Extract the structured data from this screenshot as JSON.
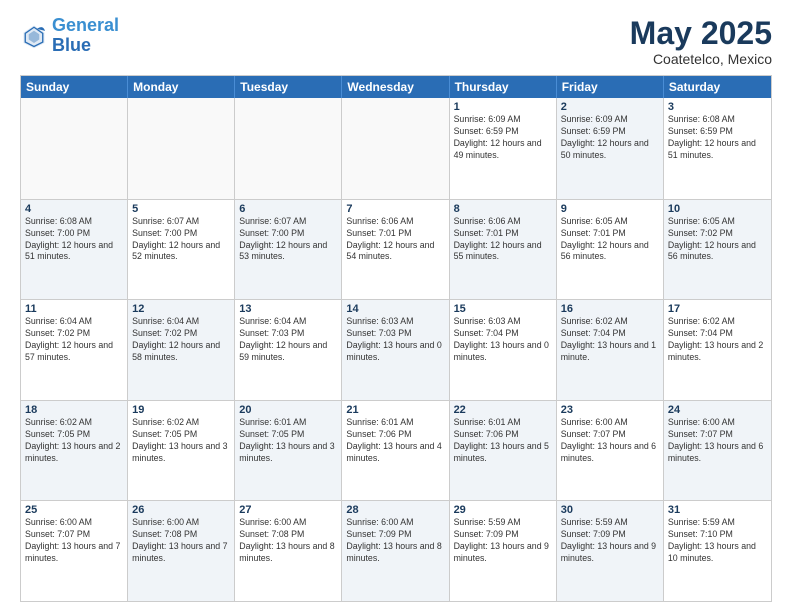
{
  "header": {
    "logo_line1": "General",
    "logo_line2": "Blue",
    "title": "May 2025",
    "location": "Coatetelco, Mexico"
  },
  "weekdays": [
    "Sunday",
    "Monday",
    "Tuesday",
    "Wednesday",
    "Thursday",
    "Friday",
    "Saturday"
  ],
  "weeks": [
    [
      {
        "day": "",
        "info": "",
        "empty": true
      },
      {
        "day": "",
        "info": "",
        "empty": true
      },
      {
        "day": "",
        "info": "",
        "empty": true
      },
      {
        "day": "",
        "info": "",
        "empty": true
      },
      {
        "day": "1",
        "info": "Sunrise: 6:09 AM\nSunset: 6:59 PM\nDaylight: 12 hours\nand 49 minutes."
      },
      {
        "day": "2",
        "info": "Sunrise: 6:09 AM\nSunset: 6:59 PM\nDaylight: 12 hours\nand 50 minutes."
      },
      {
        "day": "3",
        "info": "Sunrise: 6:08 AM\nSunset: 6:59 PM\nDaylight: 12 hours\nand 51 minutes."
      }
    ],
    [
      {
        "day": "4",
        "info": "Sunrise: 6:08 AM\nSunset: 7:00 PM\nDaylight: 12 hours\nand 51 minutes."
      },
      {
        "day": "5",
        "info": "Sunrise: 6:07 AM\nSunset: 7:00 PM\nDaylight: 12 hours\nand 52 minutes."
      },
      {
        "day": "6",
        "info": "Sunrise: 6:07 AM\nSunset: 7:00 PM\nDaylight: 12 hours\nand 53 minutes."
      },
      {
        "day": "7",
        "info": "Sunrise: 6:06 AM\nSunset: 7:01 PM\nDaylight: 12 hours\nand 54 minutes."
      },
      {
        "day": "8",
        "info": "Sunrise: 6:06 AM\nSunset: 7:01 PM\nDaylight: 12 hours\nand 55 minutes."
      },
      {
        "day": "9",
        "info": "Sunrise: 6:05 AM\nSunset: 7:01 PM\nDaylight: 12 hours\nand 56 minutes."
      },
      {
        "day": "10",
        "info": "Sunrise: 6:05 AM\nSunset: 7:02 PM\nDaylight: 12 hours\nand 56 minutes."
      }
    ],
    [
      {
        "day": "11",
        "info": "Sunrise: 6:04 AM\nSunset: 7:02 PM\nDaylight: 12 hours\nand 57 minutes."
      },
      {
        "day": "12",
        "info": "Sunrise: 6:04 AM\nSunset: 7:02 PM\nDaylight: 12 hours\nand 58 minutes."
      },
      {
        "day": "13",
        "info": "Sunrise: 6:04 AM\nSunset: 7:03 PM\nDaylight: 12 hours\nand 59 minutes."
      },
      {
        "day": "14",
        "info": "Sunrise: 6:03 AM\nSunset: 7:03 PM\nDaylight: 13 hours\nand 0 minutes."
      },
      {
        "day": "15",
        "info": "Sunrise: 6:03 AM\nSunset: 7:04 PM\nDaylight: 13 hours\nand 0 minutes."
      },
      {
        "day": "16",
        "info": "Sunrise: 6:02 AM\nSunset: 7:04 PM\nDaylight: 13 hours\nand 1 minute."
      },
      {
        "day": "17",
        "info": "Sunrise: 6:02 AM\nSunset: 7:04 PM\nDaylight: 13 hours\nand 2 minutes."
      }
    ],
    [
      {
        "day": "18",
        "info": "Sunrise: 6:02 AM\nSunset: 7:05 PM\nDaylight: 13 hours\nand 2 minutes."
      },
      {
        "day": "19",
        "info": "Sunrise: 6:02 AM\nSunset: 7:05 PM\nDaylight: 13 hours\nand 3 minutes."
      },
      {
        "day": "20",
        "info": "Sunrise: 6:01 AM\nSunset: 7:05 PM\nDaylight: 13 hours\nand 3 minutes."
      },
      {
        "day": "21",
        "info": "Sunrise: 6:01 AM\nSunset: 7:06 PM\nDaylight: 13 hours\nand 4 minutes."
      },
      {
        "day": "22",
        "info": "Sunrise: 6:01 AM\nSunset: 7:06 PM\nDaylight: 13 hours\nand 5 minutes."
      },
      {
        "day": "23",
        "info": "Sunrise: 6:00 AM\nSunset: 7:07 PM\nDaylight: 13 hours\nand 6 minutes."
      },
      {
        "day": "24",
        "info": "Sunrise: 6:00 AM\nSunset: 7:07 PM\nDaylight: 13 hours\nand 6 minutes."
      }
    ],
    [
      {
        "day": "25",
        "info": "Sunrise: 6:00 AM\nSunset: 7:07 PM\nDaylight: 13 hours\nand 7 minutes."
      },
      {
        "day": "26",
        "info": "Sunrise: 6:00 AM\nSunset: 7:08 PM\nDaylight: 13 hours\nand 7 minutes."
      },
      {
        "day": "27",
        "info": "Sunrise: 6:00 AM\nSunset: 7:08 PM\nDaylight: 13 hours\nand 8 minutes."
      },
      {
        "day": "28",
        "info": "Sunrise: 6:00 AM\nSunset: 7:09 PM\nDaylight: 13 hours\nand 8 minutes."
      },
      {
        "day": "29",
        "info": "Sunrise: 5:59 AM\nSunset: 7:09 PM\nDaylight: 13 hours\nand 9 minutes."
      },
      {
        "day": "30",
        "info": "Sunrise: 5:59 AM\nSunset: 7:09 PM\nDaylight: 13 hours\nand 9 minutes."
      },
      {
        "day": "31",
        "info": "Sunrise: 5:59 AM\nSunset: 7:10 PM\nDaylight: 13 hours\nand 10 minutes."
      }
    ]
  ]
}
